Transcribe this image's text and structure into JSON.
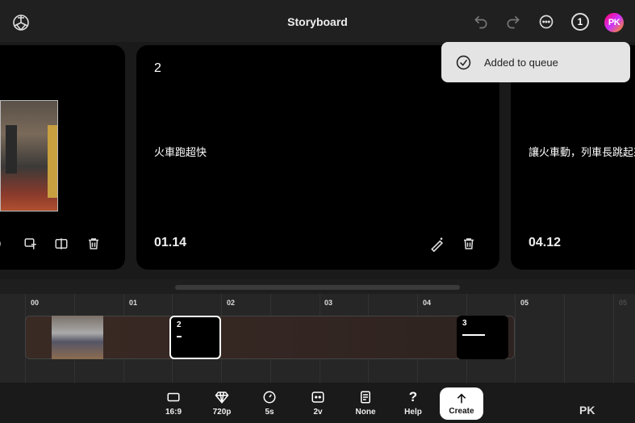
{
  "header": {
    "title": "Storyboard",
    "queue_count": "1",
    "avatar_initials": "PK"
  },
  "toast": {
    "message": "Added to queue"
  },
  "cards": [
    {
      "index": 0,
      "number": "",
      "prompt": "",
      "time": ""
    },
    {
      "index": 1,
      "number": "2",
      "prompt": "火車跑超快",
      "time": "01.14"
    },
    {
      "index": 2,
      "number": "",
      "prompt": "讓火車動，列車長跳起來",
      "time": "04.12"
    }
  ],
  "timeline": {
    "ticks": [
      "00",
      "01",
      "02",
      "03",
      "04",
      "05",
      "05"
    ],
    "clips": [
      {
        "number": "2"
      },
      {
        "number": "3"
      }
    ]
  },
  "toolbar": {
    "aspect": "16:9",
    "resolution": "720p",
    "duration": "5s",
    "variations": "2v",
    "preset": "None",
    "help": "Help",
    "create": "Create"
  },
  "watermark": "PK"
}
